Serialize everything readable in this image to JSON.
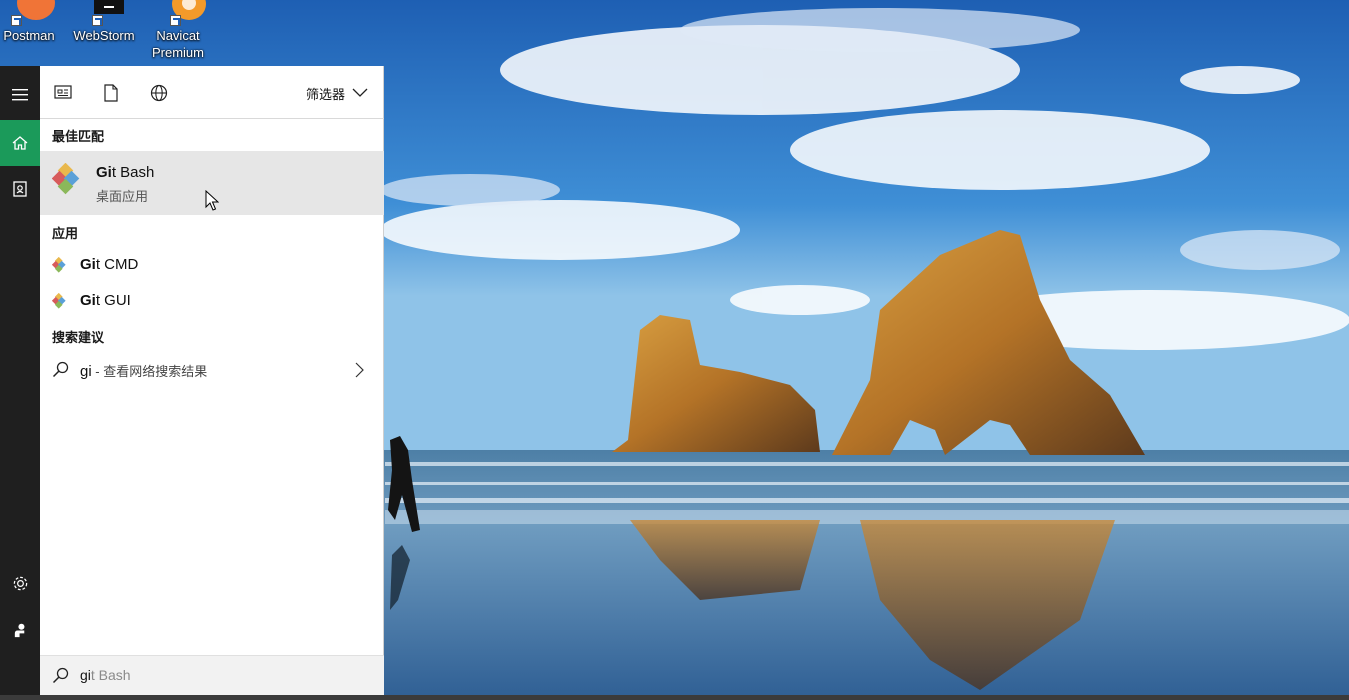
{
  "desktop": {
    "icons": [
      {
        "label": "Postman",
        "icon": "postman-icon"
      },
      {
        "label": "WebStorm",
        "icon": "webstorm-icon"
      },
      {
        "label_line1": "Navicat",
        "label_line2": "Premium",
        "icon": "navicat-icon"
      }
    ]
  },
  "start_menu": {
    "rail": [
      "hamburger-menu-icon",
      "home-icon",
      "notebook-icon",
      "settings-icon",
      "feedback-icon"
    ],
    "toolbar": {
      "icons": [
        "apps-filter-icon",
        "documents-filter-icon",
        "web-filter-icon"
      ],
      "filter_label": "筛选器"
    },
    "best_match": {
      "heading": "最佳匹配",
      "title_bold": "Gi",
      "title_rest": "t Bash",
      "subtitle": "桌面应用",
      "icon": "git-icon"
    },
    "apps": {
      "heading": "应用",
      "items": [
        {
          "bold": "Gi",
          "rest": "t CMD",
          "icon": "git-icon"
        },
        {
          "bold": "Gi",
          "rest": "t GUI",
          "icon": "git-icon"
        }
      ]
    },
    "suggestions": {
      "heading": "搜索建议",
      "query": "gi",
      "description": " - 查看网络搜索结果",
      "icon": "search-icon"
    },
    "search_box": {
      "typed": "gi",
      "ghost": "t Bash"
    }
  },
  "colors": {
    "rail_bg": "#1f1f1f",
    "rail_active": "#1b9a5a",
    "highlight": "#e6e6e6",
    "panel_bg": "#ffffff"
  }
}
